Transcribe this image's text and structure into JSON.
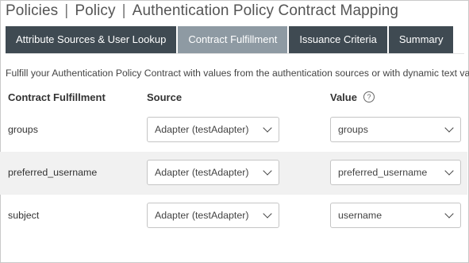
{
  "breadcrumb": [
    "Policies",
    "Policy",
    "Authentication Policy Contract Mapping"
  ],
  "tabs": [
    {
      "label": "Attribute Sources & User Lookup",
      "active": false
    },
    {
      "label": "Contract Fulfillment",
      "active": true
    },
    {
      "label": "Issuance Criteria",
      "active": false
    },
    {
      "label": "Summary",
      "active": false
    }
  ],
  "instructions": "Fulfill your Authentication Policy Contract with values from the authentication sources or with dynamic text values.",
  "table": {
    "headers": {
      "field": "Contract Fulfillment",
      "source": "Source",
      "value": "Value"
    },
    "help_icon": "?",
    "rows": [
      {
        "field": "groups",
        "source": "Adapter (testAdapter)",
        "value": "groups"
      },
      {
        "field": "preferred_username",
        "source": "Adapter (testAdapter)",
        "value": "preferred_username"
      },
      {
        "field": "subject",
        "source": "Adapter (testAdapter)",
        "value": "username"
      }
    ]
  },
  "colors": {
    "tab_bg": "#3f4a52",
    "tab_active_bg": "#8e9aa3",
    "row_shade": "#f1f1f1"
  }
}
